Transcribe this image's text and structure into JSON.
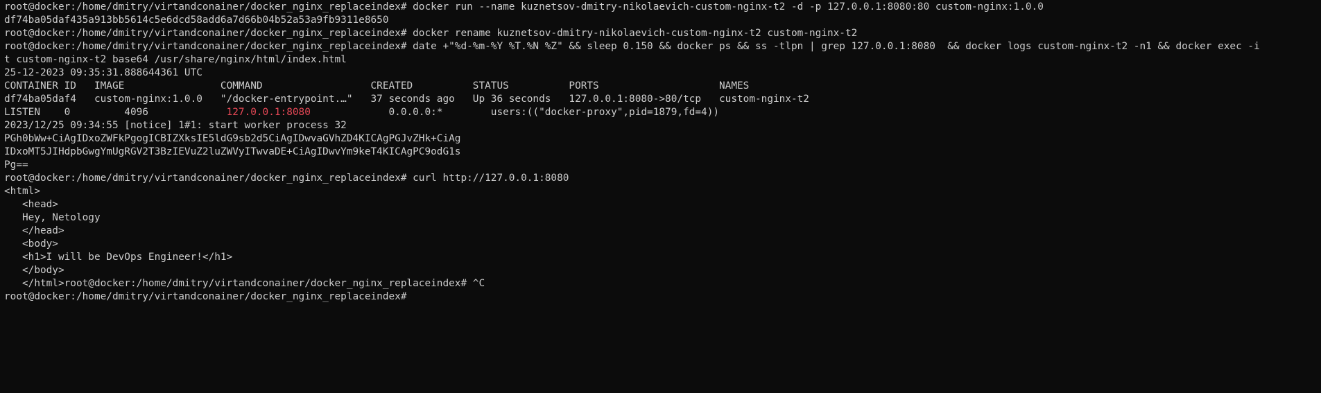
{
  "terminal": {
    "lines": [
      {
        "text": "root@docker:/home/dmitry/virtandconainer/docker_nginx_replaceindex# docker run --name kuznetsov-dmitry-nikolaevich-custom-nginx-t2 -d -p 127.0.0.1:8080:80 custom-nginx:1.0.0"
      },
      {
        "text": "df74ba05daf435a913bb5614c5e6dcd58add6a7d66b04b52a53a9fb9311e8650"
      },
      {
        "text": "root@docker:/home/dmitry/virtandconainer/docker_nginx_replaceindex# docker rename kuznetsov-dmitry-nikolaevich-custom-nginx-t2 custom-nginx-t2"
      },
      {
        "text": "root@docker:/home/dmitry/virtandconainer/docker_nginx_replaceindex# date +\"%d-%m-%Y %T.%N %Z\" && sleep 0.150 && docker ps && ss -tlpn | grep 127.0.0.1:8080  && docker logs custom-nginx-t2 -n1 && docker exec -i"
      },
      {
        "text": "t custom-nginx-t2 base64 /usr/share/nginx/html/index.html"
      },
      {
        "text": "25-12-2023 09:35:31.888644361 UTC"
      },
      {
        "text": "CONTAINER ID   IMAGE                COMMAND                  CREATED          STATUS          PORTS                    NAMES"
      },
      {
        "text": "df74ba05daf4   custom-nginx:1.0.0   \"/docker-entrypoint.…\"   37 seconds ago   Up 36 seconds   127.0.0.1:8080->80/tcp   custom-nginx-t2"
      },
      {
        "pre": "LISTEN    0         4096             ",
        "highlight": "127.0.0.1:8080",
        "post": "             0.0.0.0:*        users:((\"docker-proxy\",pid=1879,fd=4))"
      },
      {
        "text": "2023/12/25 09:34:55 [notice] 1#1: start worker process 32"
      },
      {
        "text": "PGh0bWw+CiAgIDxoZWFkPgogICBIZXksIE5ldG9sb2d5CiAgIDwvaGVhZD4KICAgPGJvZHk+CiAg"
      },
      {
        "text": "IDxoMT5JIHdpbGwgYmUgRGV2T3BzIEVuZ2luZWVyITwvaDE+CiAgIDwvYm9keT4KICAgPC9odG1s"
      },
      {
        "text": "Pg=="
      },
      {
        "text": "root@docker:/home/dmitry/virtandconainer/docker_nginx_replaceindex# curl http://127.0.0.1:8080"
      },
      {
        "text": "<html>"
      },
      {
        "text": "   <head>"
      },
      {
        "text": "   Hey, Netology"
      },
      {
        "text": "   </head>"
      },
      {
        "text": "   <body>"
      },
      {
        "text": "   <h1>I will be DevOps Engineer!</h1>"
      },
      {
        "text": "   </body>"
      },
      {
        "text": "   </html>root@docker:/home/dmitry/virtandconainer/docker_nginx_replaceindex# ^C"
      },
      {
        "text": "root@docker:/home/dmitry/virtandconainer/docker_nginx_replaceindex#"
      }
    ]
  },
  "colors": {
    "background": "#0c0c0c",
    "foreground": "#cccccc",
    "highlight": "#e74856"
  }
}
